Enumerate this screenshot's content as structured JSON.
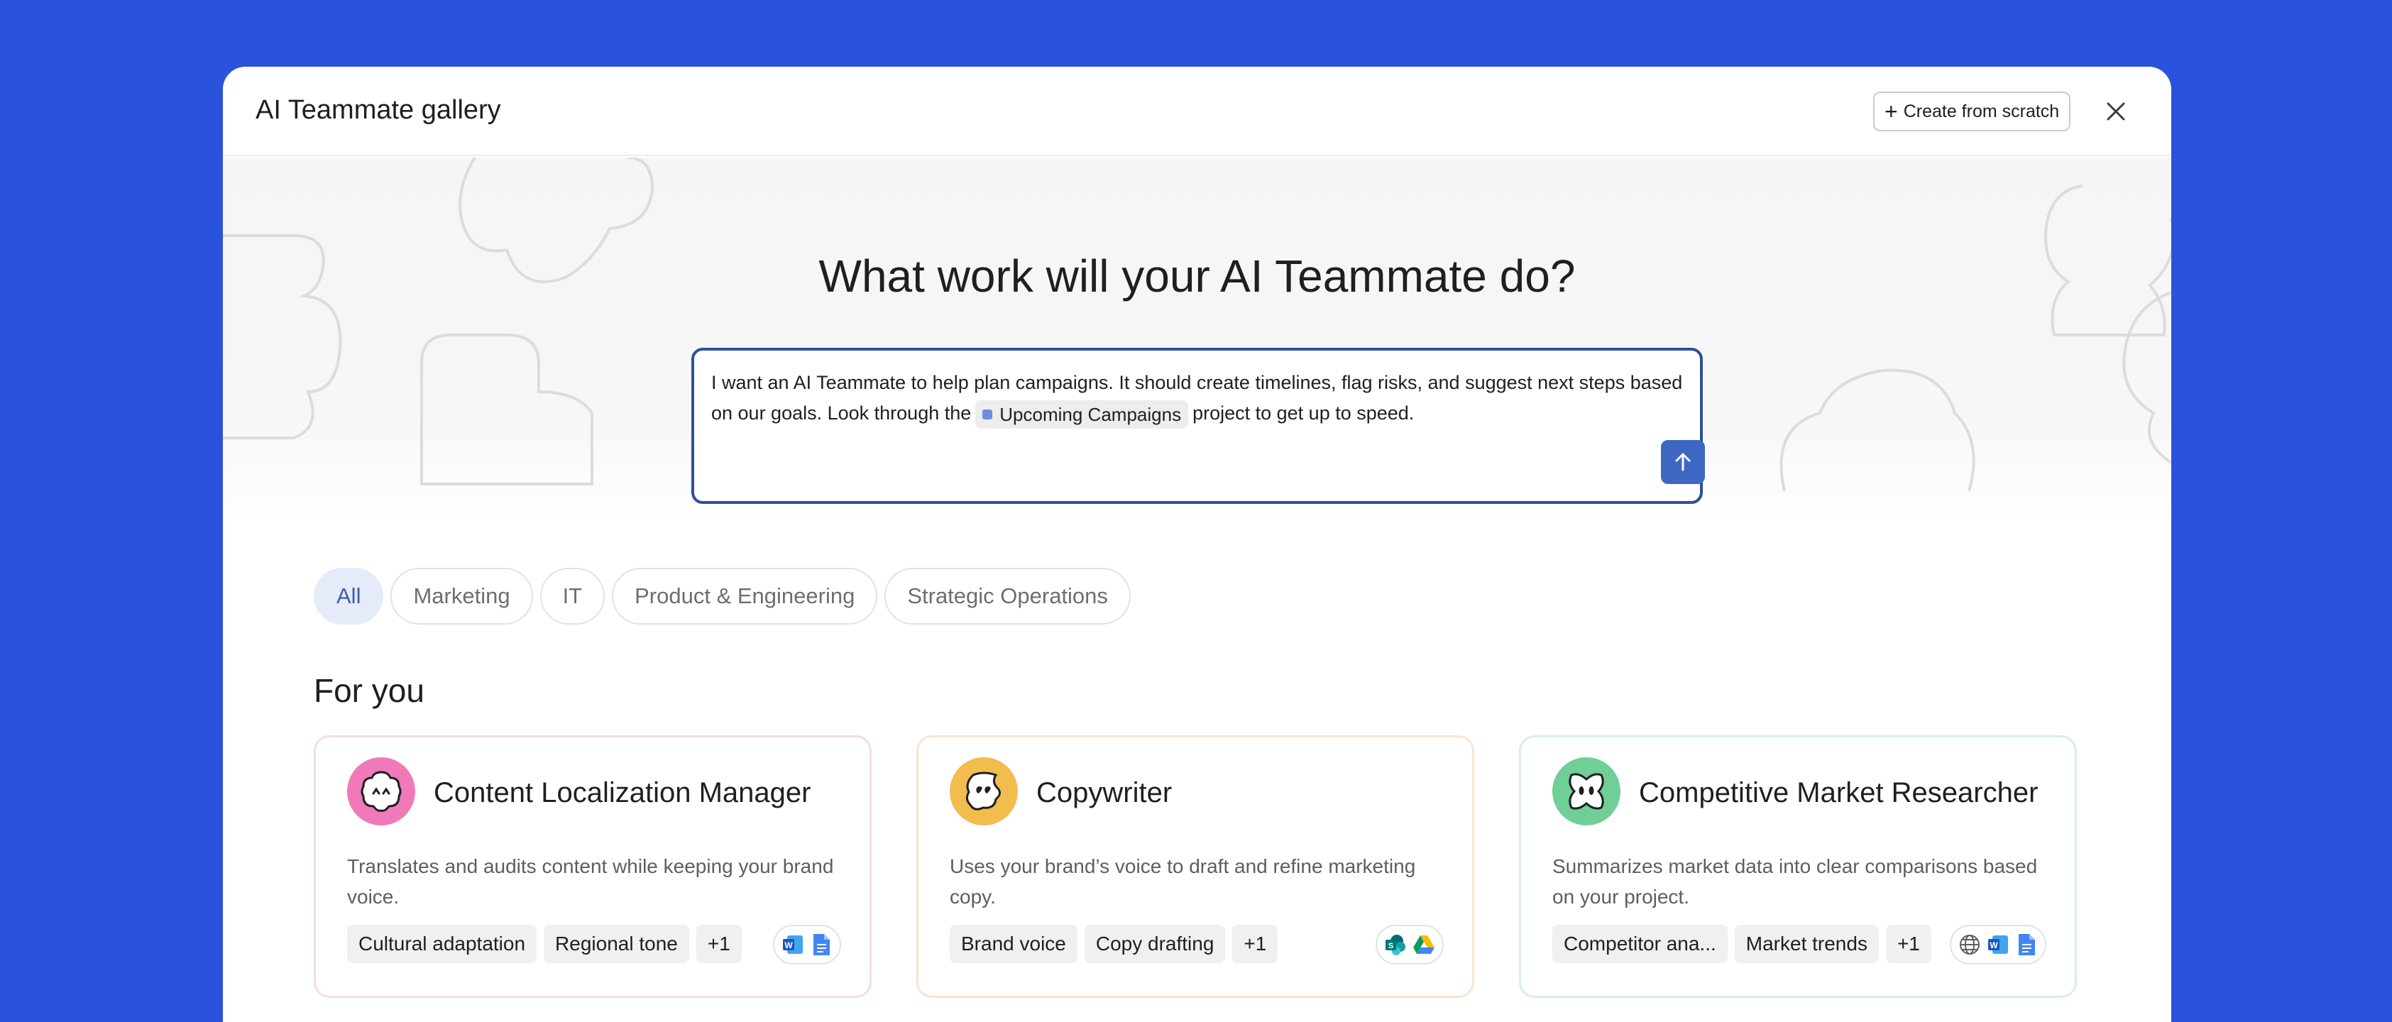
{
  "modal": {
    "title": "AI Teammate gallery",
    "create_label": "Create from scratch"
  },
  "hero": {
    "heading": "What work will your AI Teammate do?",
    "prompt": {
      "before_chip": "I want an AI Teammate to help plan campaigns. It should create timelines, flag risks, and suggest next steps based on our goals. Look through the",
      "chip_label": "Upcoming Campaigns",
      "after_chip": "project to get up to speed."
    }
  },
  "filters": [
    {
      "label": "All",
      "active": true
    },
    {
      "label": "Marketing",
      "active": false
    },
    {
      "label": "IT",
      "active": false
    },
    {
      "label": "Product & Engineering",
      "active": false
    },
    {
      "label": "Strategic Operations",
      "active": false
    }
  ],
  "section_title": "For you",
  "cards": [
    {
      "title": "Content Localization Manager",
      "description": "Translates and audits content while keeping your brand voice.",
      "tags": [
        "Cultural adaptation",
        "Regional tone",
        "+1"
      ],
      "apps": [
        "word-icon",
        "google-docs-icon"
      ],
      "avatar_color": "#f07ab9"
    },
    {
      "title": "Copywriter",
      "description": "Uses your brand’s voice to draft and refine marketing copy.",
      "tags": [
        "Brand voice",
        "Copy drafting",
        "+1"
      ],
      "apps": [
        "sharepoint-icon",
        "google-drive-icon"
      ],
      "avatar_color": "#f3bc4f"
    },
    {
      "title": "Competitive Market Researcher",
      "description": "Summarizes market data into clear comparisons based on your project.",
      "tags": [
        "Competitor ana...",
        "Market trends",
        "+1"
      ],
      "apps": [
        "globe-icon",
        "word-icon",
        "google-docs-icon"
      ],
      "avatar_color": "#6fcf97"
    }
  ],
  "colors": {
    "background": "#2b52dc",
    "accent": "#3e67c4",
    "prompt_border": "#2f4f9a"
  }
}
